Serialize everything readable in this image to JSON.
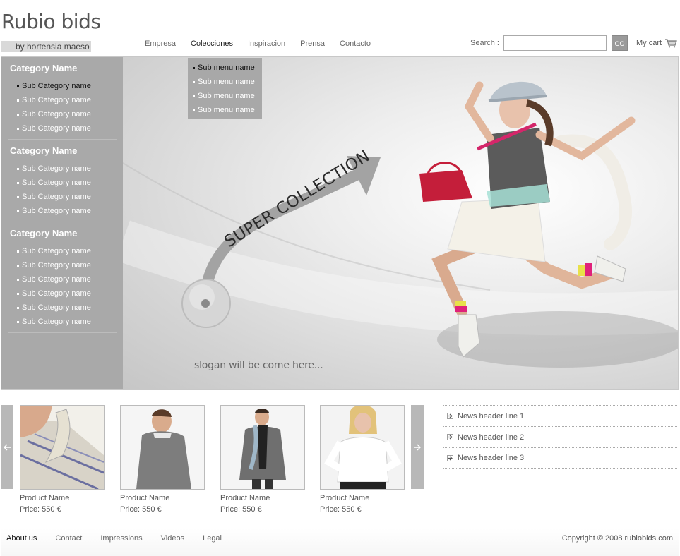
{
  "logo": {
    "title": "Rubio bids",
    "subtitle": "by hortensia maeso"
  },
  "nav": {
    "items": [
      {
        "label": "Empresa"
      },
      {
        "label": "Colecciones"
      },
      {
        "label": "Inspiracion"
      },
      {
        "label": "Prensa"
      },
      {
        "label": "Contacto"
      }
    ],
    "active": "Colecciones"
  },
  "search": {
    "label": "Search :",
    "value": "",
    "placeholder": "",
    "button": "GO"
  },
  "cart": {
    "label": "My cart",
    "icon": "cart-icon"
  },
  "submenu": {
    "items": [
      {
        "label": "Sub menu name"
      },
      {
        "label": "Sub menu name"
      },
      {
        "label": "Sub menu name"
      },
      {
        "label": "Sub menu name"
      }
    ]
  },
  "sidebar": {
    "categories": [
      {
        "title": "Category Name",
        "subs": [
          "Sub Category name",
          "Sub Category name",
          "Sub Category name",
          "Sub Category name"
        ]
      },
      {
        "title": "Category Name",
        "subs": [
          "Sub Category name",
          "Sub Category name",
          "Sub Category name",
          "Sub Category name"
        ]
      },
      {
        "title": "Category Name",
        "subs": [
          "Sub Category name",
          "Sub Category name",
          "Sub Category name",
          "Sub Category name",
          "Sub Category name",
          "Sub Category name"
        ]
      }
    ]
  },
  "banner": {
    "headline": "SUPER COLLECTION",
    "slogan": "slogan will be come here..."
  },
  "carousel": {
    "prev_icon": "arrow-left-icon",
    "next_icon": "arrow-right-icon"
  },
  "products": [
    {
      "name": "Product Name",
      "price": "Price: 550 €"
    },
    {
      "name": "Product Name",
      "price": "Price: 550 €"
    },
    {
      "name": "Product Name",
      "price": "Price: 550 €"
    },
    {
      "name": "Product Name",
      "price": "Price: 550 €"
    }
  ],
  "news": [
    {
      "title": "News header line 1"
    },
    {
      "title": "News header line 2"
    },
    {
      "title": "News header line 3"
    }
  ],
  "footer": {
    "links": [
      {
        "label": "About us"
      },
      {
        "label": "Contact"
      },
      {
        "label": "Impressions"
      },
      {
        "label": "Videos"
      },
      {
        "label": "Legal"
      }
    ],
    "copyright": "Copyright © 2008 rubiobids.com"
  },
  "colors": {
    "sidebar": "#a9a9a9",
    "submenu": "#a8a8a8",
    "accent_pink": "#d4266a",
    "bag": "#c41e3a"
  }
}
